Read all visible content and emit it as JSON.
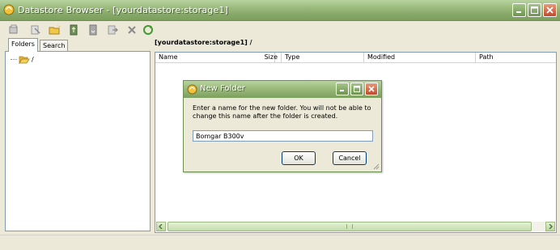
{
  "window": {
    "title": "Datastore Browser - [yourdatastore:storage1]"
  },
  "toolbar": {
    "buttons": [
      {
        "name": "search-datastore-icon"
      },
      {
        "name": "browse-icon"
      },
      {
        "name": "new-folder-icon"
      },
      {
        "name": "upload-icon"
      },
      {
        "name": "download-icon"
      },
      {
        "name": "move-icon"
      },
      {
        "name": "delete-icon"
      },
      {
        "name": "refresh-icon"
      }
    ]
  },
  "left_pane": {
    "tabs": [
      "Folders",
      "Search"
    ],
    "tree_root": "/"
  },
  "right_pane": {
    "path": "[yourdatastore:storage1] /",
    "columns": [
      "Name",
      "Size",
      "Type",
      "Modified",
      "Path"
    ]
  },
  "dialog": {
    "title": "New Folder",
    "message": "Enter a name for the new folder. You will not be able to change this name after the folder is created.",
    "input_value": "Bomgar B300v",
    "ok_label": "OK",
    "cancel_label": "Cancel"
  },
  "colors": {
    "titlebar": "#9dbd7f",
    "close_button": "#c5472a",
    "window_bg": "#ece9d8"
  }
}
